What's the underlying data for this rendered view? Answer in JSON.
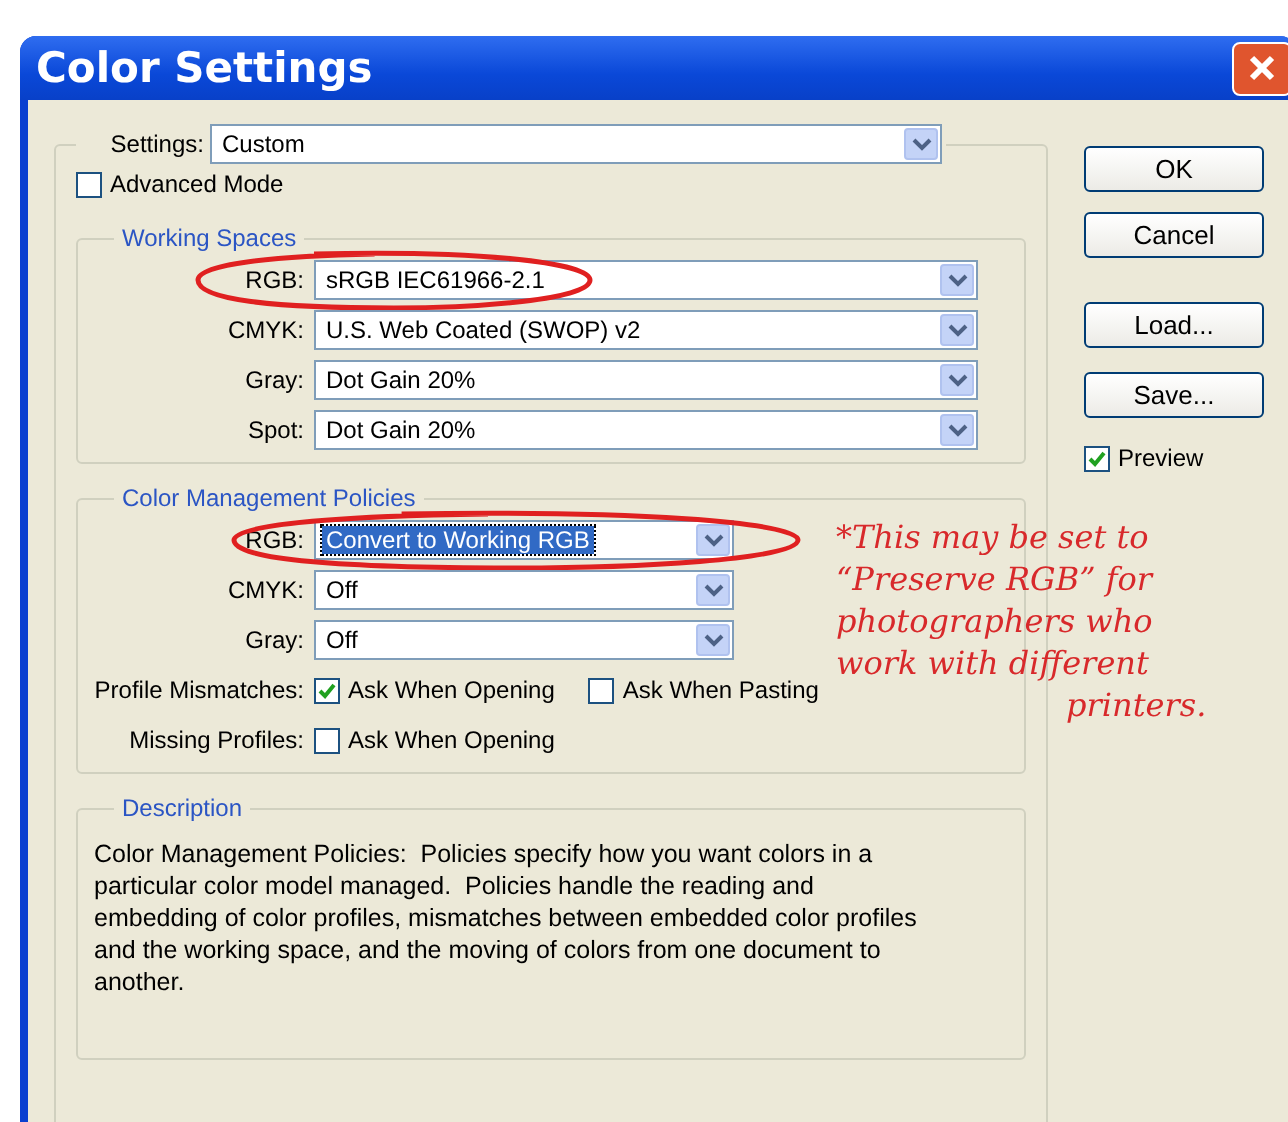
{
  "window": {
    "title": "Color Settings"
  },
  "settings": {
    "label": "Settings:",
    "value": "Custom"
  },
  "advanced_mode": {
    "label": "Advanced Mode",
    "checked": false
  },
  "working_spaces": {
    "title": "Working Spaces",
    "rows": [
      {
        "label": "RGB:",
        "value": "sRGB IEC61966-2.1",
        "highlighted": false,
        "circled": true
      },
      {
        "label": "CMYK:",
        "value": "U.S. Web Coated (SWOP) v2",
        "highlighted": false,
        "circled": false
      },
      {
        "label": "Gray:",
        "value": "Dot Gain 20%",
        "highlighted": false,
        "circled": false
      },
      {
        "label": "Spot:",
        "value": "Dot Gain 20%",
        "highlighted": false,
        "circled": false
      }
    ]
  },
  "policies": {
    "title": "Color Management Policies",
    "rows": [
      {
        "label": "RGB:",
        "value": "Convert to Working RGB",
        "highlighted": true,
        "circled": true
      },
      {
        "label": "CMYK:",
        "value": "Off",
        "highlighted": false,
        "circled": false
      },
      {
        "label": "Gray:",
        "value": "Off",
        "highlighted": false,
        "circled": false
      }
    ],
    "check_rows": [
      {
        "label": "Profile Mismatches:",
        "options": [
          {
            "label": "Ask When Opening",
            "checked": true
          },
          {
            "label": "Ask When Pasting",
            "checked": false
          }
        ]
      },
      {
        "label": "Missing Profiles:",
        "options": [
          {
            "label": "Ask When Opening",
            "checked": false
          }
        ]
      }
    ]
  },
  "description": {
    "title": "Description",
    "text": "Color Management Policies:  Policies specify how you want colors in a particular color model managed.  Policies handle the reading and embedding of color profiles, mismatches between embedded color profiles and the working space, and the moving of colors from one document to another."
  },
  "buttons": [
    "OK",
    "Cancel",
    "Load...",
    "Save..."
  ],
  "preview": {
    "label": "Preview",
    "checked": true
  },
  "annotation": {
    "lines": [
      "*This may be set to",
      "“Preserve RGB” for",
      "photographers who",
      "work with different",
      "printers."
    ]
  }
}
